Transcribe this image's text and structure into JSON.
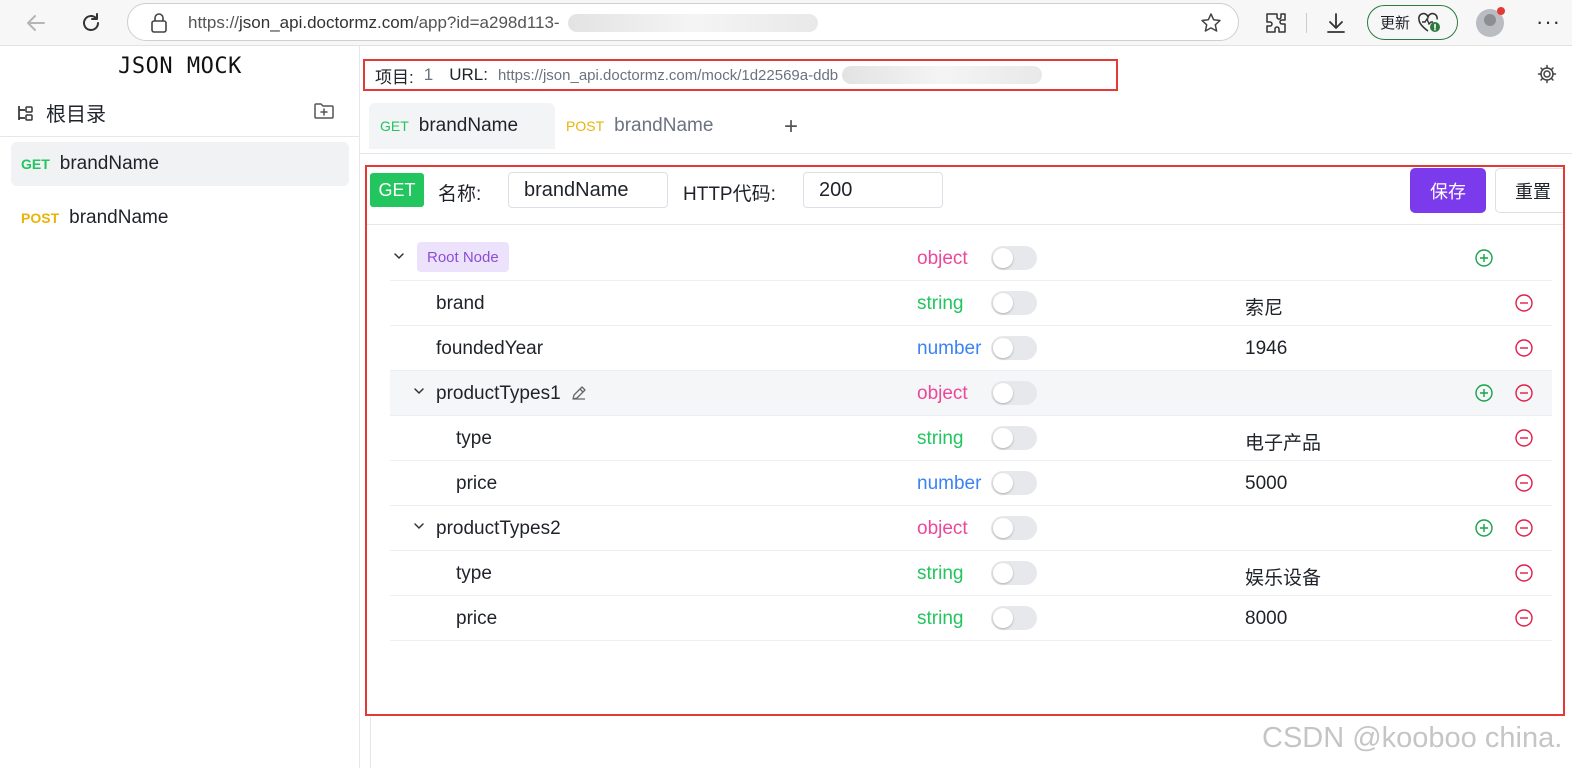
{
  "browser": {
    "url_prefix": "https://",
    "url_domain": "json_api.doctormz.com",
    "url_path": "/app?id=a298d113-",
    "update_label": "更新"
  },
  "sidebar": {
    "title": "JSON MOCK",
    "root_label": "根目录",
    "items": [
      {
        "method": "GET",
        "name": "brandName"
      },
      {
        "method": "POST",
        "name": "brandName"
      }
    ]
  },
  "project": {
    "project_label": "项目:",
    "project_value": "1",
    "url_label": "URL:",
    "url_value": "https://json_api.doctormz.com/mock/1d22569a-ddb"
  },
  "tabs": [
    {
      "method": "GET",
      "name": "brandName"
    },
    {
      "method": "POST",
      "name": "brandName"
    }
  ],
  "tab_add": "+",
  "editor": {
    "method": "GET",
    "name_label": "名称:",
    "name_value": "brandName",
    "http_label": "HTTP代码:",
    "http_value": "200",
    "save_label": "保存",
    "reset_label": "重置"
  },
  "tree": {
    "root_label": "Root Node",
    "root_type": "object",
    "rows": [
      {
        "key": "brand",
        "type": "string",
        "value": "索尼"
      },
      {
        "key": "foundedYear",
        "type": "number",
        "value": "1946"
      },
      {
        "key": "productTypes1",
        "type": "object",
        "value": ""
      },
      {
        "key": "type",
        "type": "string",
        "value": "电子产品"
      },
      {
        "key": "price",
        "type": "number",
        "value": "5000"
      },
      {
        "key": "productTypes2",
        "type": "object",
        "value": ""
      },
      {
        "key": "type",
        "type": "string",
        "value": "娱乐设备"
      },
      {
        "key": "price",
        "type": "string",
        "value": "8000"
      }
    ]
  },
  "watermark": "CSDN @kooboo china.",
  "colors": {
    "accent": "#7c3aed",
    "get": "#22c55e",
    "post": "#eab308",
    "object": "#ec4899",
    "number": "#3b82f6",
    "highlight_border": "#e53935"
  }
}
